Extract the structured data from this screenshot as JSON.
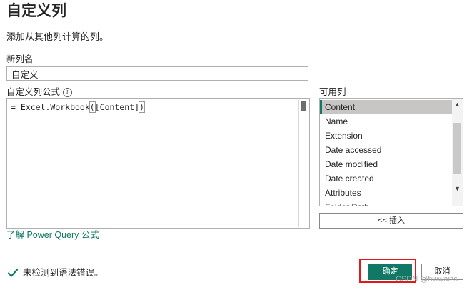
{
  "dialog": {
    "title": "自定义列",
    "subtitle": "添加从其他列计算的列。"
  },
  "new_column": {
    "label": "新列名",
    "value": "自定义"
  },
  "formula": {
    "label": "自定义列公式",
    "prefix": "= Excel.Workbook",
    "paren_open": "(",
    "args": "[Content]",
    "paren_close": ")"
  },
  "available_columns": {
    "label": "可用列",
    "items": [
      "Content",
      "Name",
      "Extension",
      "Date accessed",
      "Date modified",
      "Date created",
      "Attributes",
      "Folder Path"
    ],
    "selected_index": 0
  },
  "insert_button": {
    "label": "<< 插入"
  },
  "learn_link": {
    "label": "了解 Power Query 公式"
  },
  "status": {
    "text": "未检测到语法错误。",
    "color": "#117865"
  },
  "buttons": {
    "ok": "确定",
    "cancel": "取消"
  },
  "watermark": "CSDN @hwwaizs",
  "colors": {
    "accent": "#117865",
    "highlight": "#e0191b"
  }
}
